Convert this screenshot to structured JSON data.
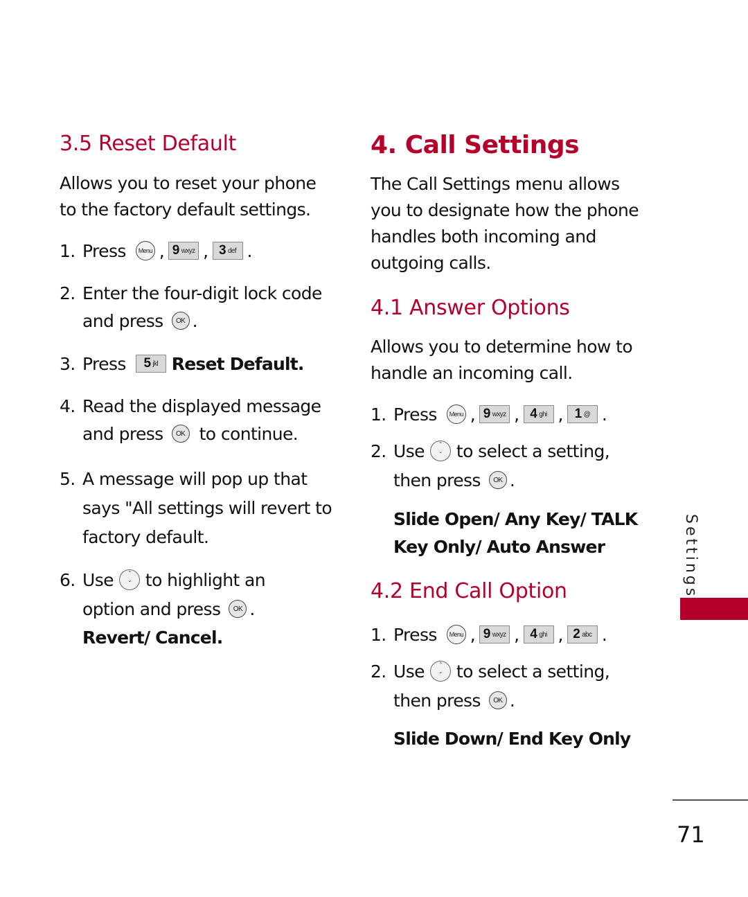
{
  "left": {
    "section_heading": "3.5 Reset Default",
    "intro": [
      "Allows you to reset your phone",
      "to the factory default settings."
    ],
    "step1": {
      "num": "1.",
      "text": "Press",
      "keys": [
        {
          "digit": "Menu"
        },
        {
          "digit": "9",
          "letters": "wxyz"
        },
        {
          "digit": "3",
          "letters": "def"
        }
      ]
    },
    "step2": {
      "num": "2.",
      "line1": "Enter the four-digit lock code",
      "line2": "and press",
      "ok": "OK"
    },
    "step3": {
      "num": "3.",
      "text": "Press",
      "key": {
        "digit": "5",
        "letters": "jkl"
      },
      "option": "Reset Default."
    },
    "step4": {
      "num": "4.",
      "line1": "Read the displayed message",
      "line2_pre": "and press",
      "ok": "OK",
      "line2_post": "to continue."
    },
    "step5": {
      "num": "5.",
      "lines": [
        "A message will pop up that",
        "says \"All settings will revert to",
        "factory default."
      ]
    },
    "step6": {
      "num": "6.",
      "line1_pre": "Use",
      "line1_post": "to highlight an",
      "line2": "option and press",
      "ok": "OK",
      "options": "Revert/ Cancel."
    }
  },
  "right": {
    "chapter_heading": "4. Call Settings",
    "intro": [
      "The Call Settings menu allows",
      "you to designate how the phone",
      "handles both incoming and",
      "outgoing calls."
    ],
    "answer_options": {
      "heading": "4.1 Answer Options",
      "intro": [
        "Allows you to determine how to",
        "handle an incoming call."
      ],
      "step1": {
        "num": "1.",
        "text": "Press",
        "keys": [
          {
            "digit": "Menu"
          },
          {
            "digit": "9",
            "letters": "wxyz"
          },
          {
            "digit": "4",
            "letters": "ghi"
          },
          {
            "digit": "1",
            "letters": "@"
          }
        ]
      },
      "step2": {
        "num": "2.",
        "pre": "Use",
        "post": "to select a setting,",
        "line2": "then press",
        "ok": "OK"
      },
      "options": [
        "Slide Open/ Any Key/ TALK",
        "Key Only/ Auto Answer"
      ]
    },
    "end_call_option": {
      "heading": "4.2 End Call Option",
      "step1": {
        "num": "1.",
        "text": "Press",
        "keys": [
          {
            "digit": "Menu"
          },
          {
            "digit": "9",
            "letters": "wxyz"
          },
          {
            "digit": "4",
            "letters": "ghi"
          },
          {
            "digit": "2",
            "letters": "abc"
          }
        ]
      },
      "step2": {
        "num": "2.",
        "pre": "Use",
        "post": "to select a setting,",
        "line2": "then press",
        "ok": "OK"
      },
      "options": "Slide Down/ End Key Only"
    }
  },
  "sidebar": {
    "tab_label": "Settings",
    "accent_color": "#b5002c"
  },
  "footer": {
    "page_number": "71"
  }
}
